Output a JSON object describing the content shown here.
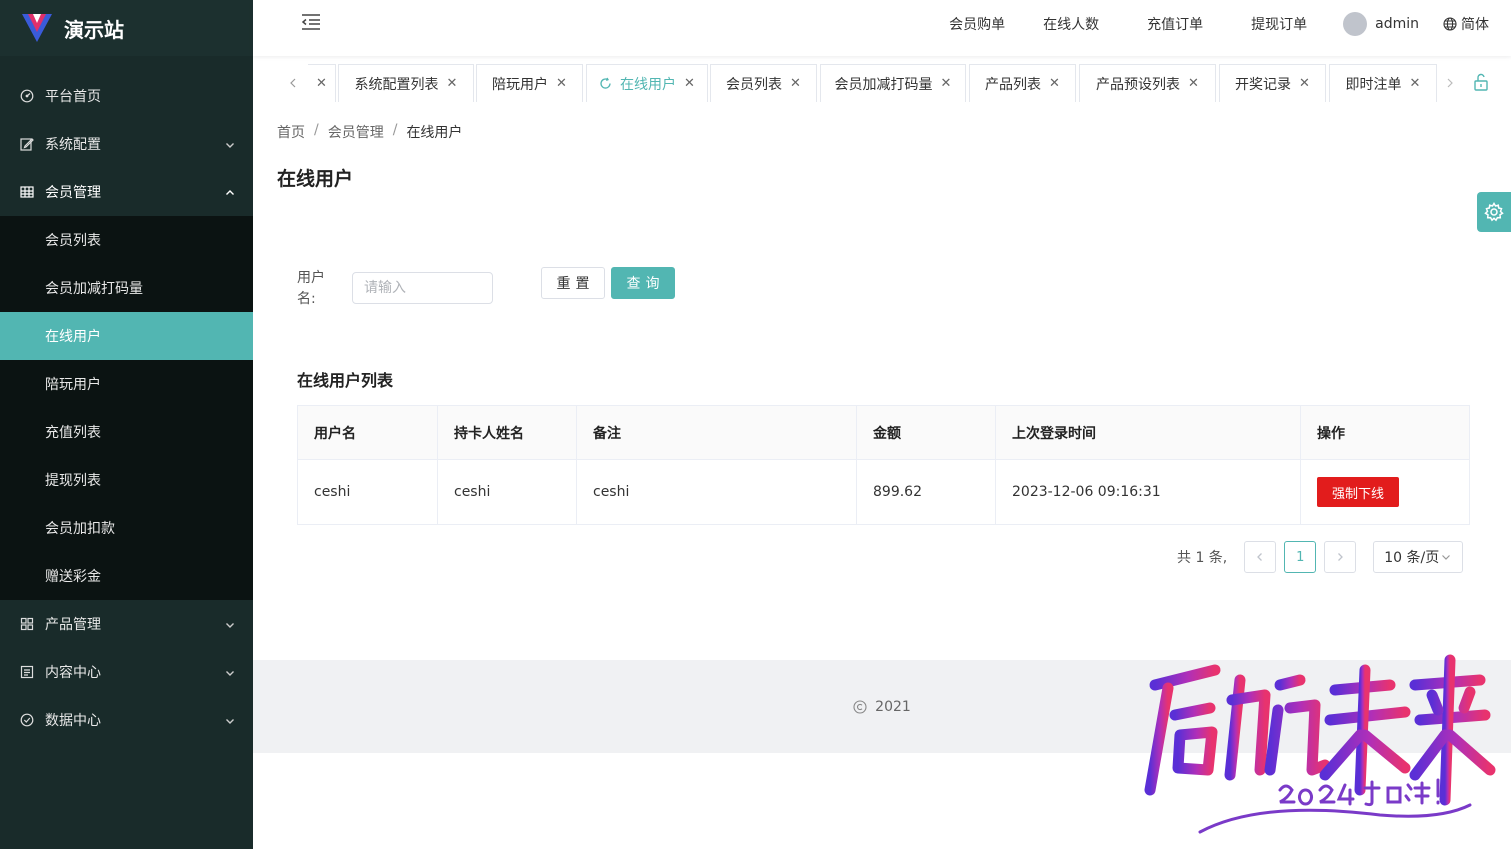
{
  "app": {
    "title": "演示站"
  },
  "colors": {
    "accent": "#52b6b2",
    "danger": "#e21c1c",
    "sidebar_bg": "#192b2a"
  },
  "sidebar": {
    "items": [
      {
        "label": "平台首页",
        "icon": "dashboard-icon"
      },
      {
        "label": "系统配置",
        "icon": "edit-icon",
        "expandable": true
      },
      {
        "label": "会员管理",
        "icon": "grid-icon",
        "expanded": true,
        "children": [
          {
            "label": "会员列表"
          },
          {
            "label": "会员加减打码量"
          },
          {
            "label": "在线用户",
            "active": true
          },
          {
            "label": "陪玩用户"
          },
          {
            "label": "充值列表"
          },
          {
            "label": "提现列表"
          },
          {
            "label": "会员加扣款"
          },
          {
            "label": "赠送彩金"
          }
        ]
      },
      {
        "label": "产品管理",
        "icon": "apps-icon",
        "expandable": true
      },
      {
        "label": "内容中心",
        "icon": "document-icon",
        "expandable": true
      },
      {
        "label": "数据中心",
        "icon": "check-circle-icon",
        "expandable": true
      }
    ]
  },
  "header": {
    "nav": [
      "会员购单",
      "在线人数",
      "充值订单",
      "提现订单"
    ],
    "user": "admin",
    "language": "简体"
  },
  "tabs": [
    {
      "label": "系统配置列表"
    },
    {
      "label": "陪玩用户"
    },
    {
      "label": "在线用户",
      "active": true
    },
    {
      "label": "会员列表"
    },
    {
      "label": "会员加减打码量"
    },
    {
      "label": "产品列表"
    },
    {
      "label": "产品预设列表"
    },
    {
      "label": "开奖记录"
    },
    {
      "label": "即时注单"
    }
  ],
  "breadcrumb": [
    "首页",
    "会员管理",
    "在线用户"
  ],
  "page_title": "在线用户",
  "search_form": {
    "username_label": "用户名:",
    "username_placeholder": "请输入",
    "reset_label": "重置",
    "query_label": "查询"
  },
  "table": {
    "title": "在线用户列表",
    "columns": [
      "用户名",
      "持卡人姓名",
      "备注",
      "金额",
      "上次登录时间",
      "操作"
    ],
    "rows": [
      {
        "username": "ceshi",
        "card_holder": "ceshi",
        "remark": "ceshi",
        "amount": "899.62",
        "last_login": "2023-12-06 09:16:31",
        "action": "强制下线"
      }
    ]
  },
  "pagination": {
    "total": "共 1 条,",
    "current_page": "1",
    "page_size": "10 条/页"
  },
  "footer": {
    "copyright": "2021"
  },
  "watermark": {
    "main": "启航未来",
    "sub": "2024加油!"
  }
}
